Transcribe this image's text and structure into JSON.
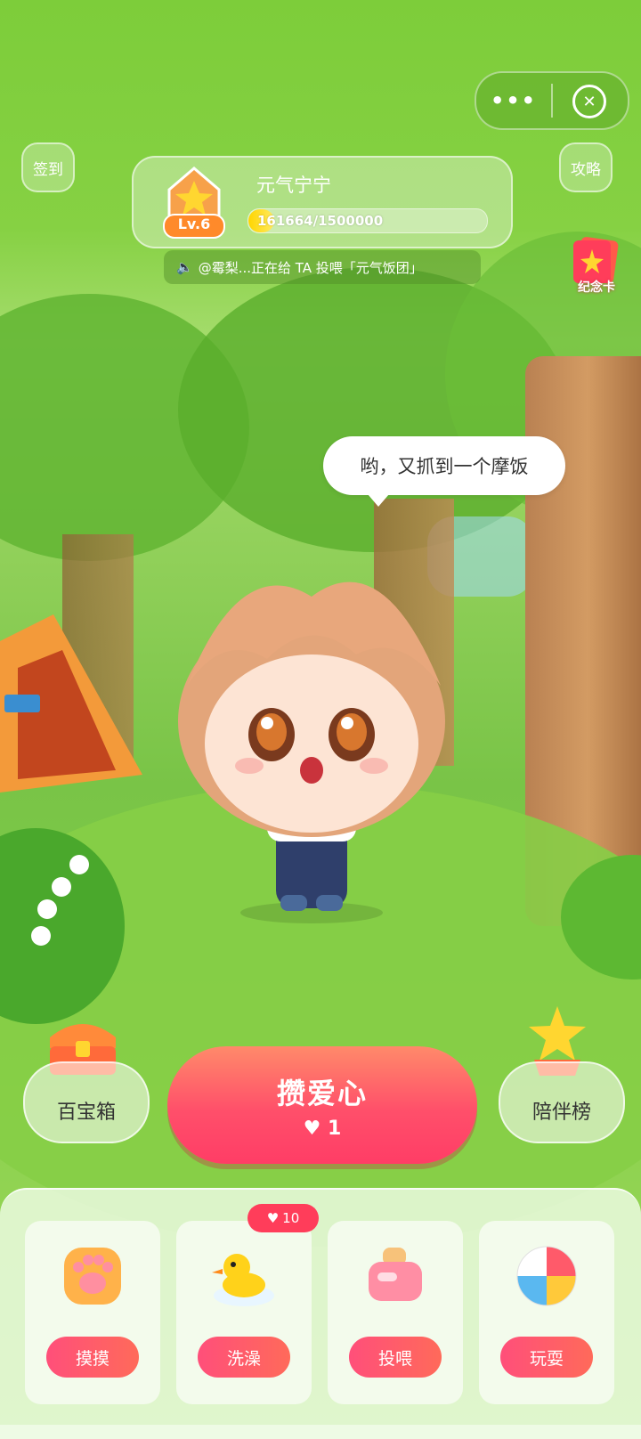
{
  "top": {
    "checkin_label": "签到",
    "guide_label": "攻略",
    "more_glyph": "•••",
    "close_glyph": "✕"
  },
  "profile": {
    "level_label": "Lv.6",
    "name": "元气宁宁",
    "xp_text": "161664/1500000",
    "xp_fraction": 0.108
  },
  "notice": {
    "text": "@霉梨...正在给 TA 投喂「元气饭团」"
  },
  "card": {
    "label": "纪念卡"
  },
  "speech": {
    "text": "哟，又抓到一个摩饭"
  },
  "actions_main": {
    "treasure_label": "百宝箱",
    "collect_label": "攒爱心",
    "heart_count": "1",
    "rank_label": "陪伴榜"
  },
  "activities": [
    {
      "label": "摸摸",
      "icon": "paw-icon"
    },
    {
      "label": "洗澡",
      "icon": "duck-icon",
      "cost": "10"
    },
    {
      "label": "投喂",
      "icon": "toaster-icon"
    },
    {
      "label": "玩耍",
      "icon": "ball-icon"
    }
  ],
  "colors": {
    "accent": "#ff4f6a",
    "background": "#7ecb46",
    "xp_fill": "#ffd500"
  }
}
